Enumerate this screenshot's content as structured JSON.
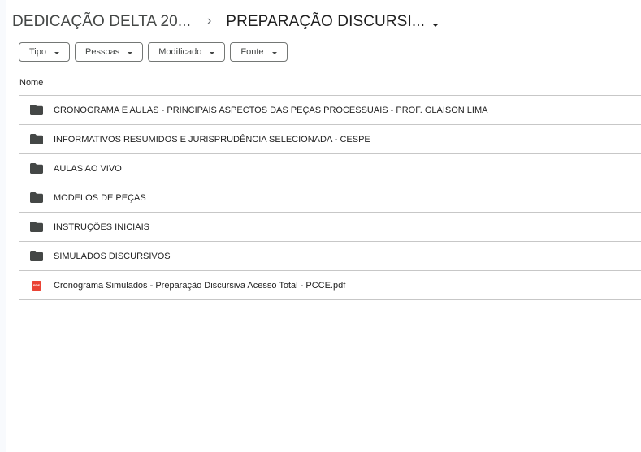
{
  "breadcrumb": {
    "parent": "DEDICAÇÃO DELTA 20...",
    "separator": "›",
    "current": "PREPARAÇÃO DISCURSI..."
  },
  "filters": [
    {
      "label": "Tipo"
    },
    {
      "label": "Pessoas"
    },
    {
      "label": "Modificado"
    },
    {
      "label": "Fonte"
    }
  ],
  "list": {
    "column_header": "Nome",
    "items": [
      {
        "type": "folder",
        "icon": "folder-icon",
        "name": "CRONOGRAMA E AULAS - PRINCIPAIS ASPECTOS DAS PEÇAS PROCESSUAIS - PROF. GLAISON LIMA"
      },
      {
        "type": "folder",
        "icon": "folder-icon",
        "name": "INFORMATIVOS RESUMIDOS E JURISPRUDÊNCIA SELECIONADA - CESPE"
      },
      {
        "type": "folder",
        "icon": "folder-icon",
        "name": "AULAS AO VIVO"
      },
      {
        "type": "folder",
        "icon": "folder-icon",
        "name": "MODELOS DE PEÇAS"
      },
      {
        "type": "folder",
        "icon": "folder-icon",
        "name": "INSTRUÇÕES INICIAIS"
      },
      {
        "type": "folder",
        "icon": "folder-icon",
        "name": "SIMULADOS DISCURSIVOS"
      },
      {
        "type": "pdf",
        "icon": "pdf-icon",
        "icon_text": "PDF",
        "name": "Cronograma Simulados - Preparação Discursiva Acesso Total - PCCE.pdf"
      }
    ]
  },
  "colors": {
    "folder": "#444746",
    "pdf": "#ea4335",
    "divider": "#c7c7c7",
    "chip_border": "#747775"
  }
}
